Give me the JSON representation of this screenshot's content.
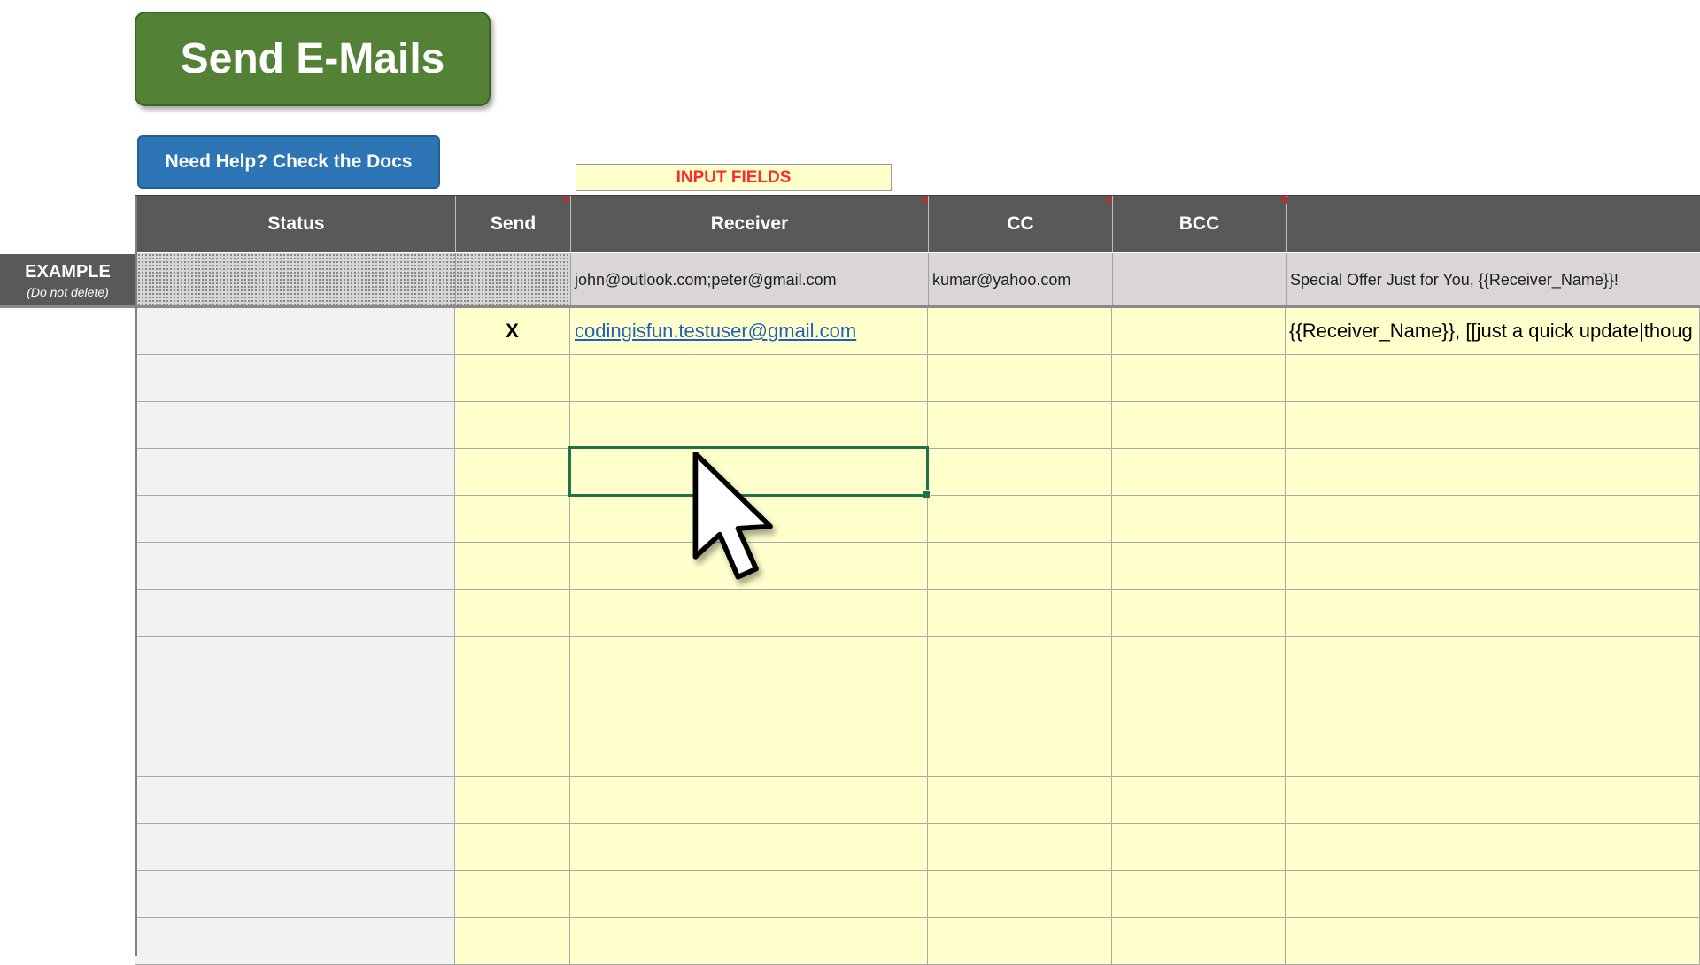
{
  "buttons": {
    "send": "Send E-Mails",
    "help": "Need Help? Check the Docs"
  },
  "input_fields_label": "INPUT FIELDS",
  "columns": [
    "Status",
    "Send",
    "Receiver",
    "CC",
    "BCC",
    ""
  ],
  "example": {
    "label": "EXAMPLE",
    "sublabel": "(Do not delete)",
    "receiver": "john@outlook.com;peter@gmail.com",
    "cc": "kumar@yahoo.com",
    "bcc": "",
    "subject": "Special Offer Just for You, {{Receiver_Name}}!"
  },
  "rows": [
    {
      "status": "",
      "send": "X",
      "receiver": "codingisfun.testuser@gmail.com",
      "cc": "",
      "bcc": "",
      "subject": "{{Receiver_Name}}, [[just a quick update|thoug"
    }
  ],
  "colors": {
    "send_button": "#538135",
    "help_button": "#2e75b6",
    "header": "#595959",
    "input_cell": "#ffffcc",
    "selection": "#217346"
  }
}
